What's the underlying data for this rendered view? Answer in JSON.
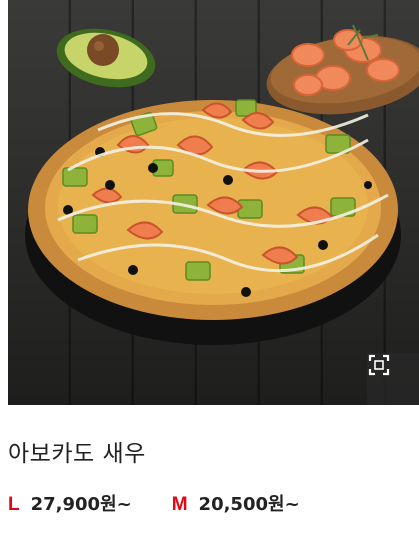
{
  "product": {
    "name": "아보카도 새우",
    "image_alt": "아보카도 새우 피자",
    "zoom_icon": "expand-icon"
  },
  "prices": [
    {
      "size": "L",
      "price": "27,900원~"
    },
    {
      "size": "M",
      "price": "20,500원~"
    }
  ],
  "colors": {
    "accent": "#e30613",
    "text": "#222222"
  }
}
